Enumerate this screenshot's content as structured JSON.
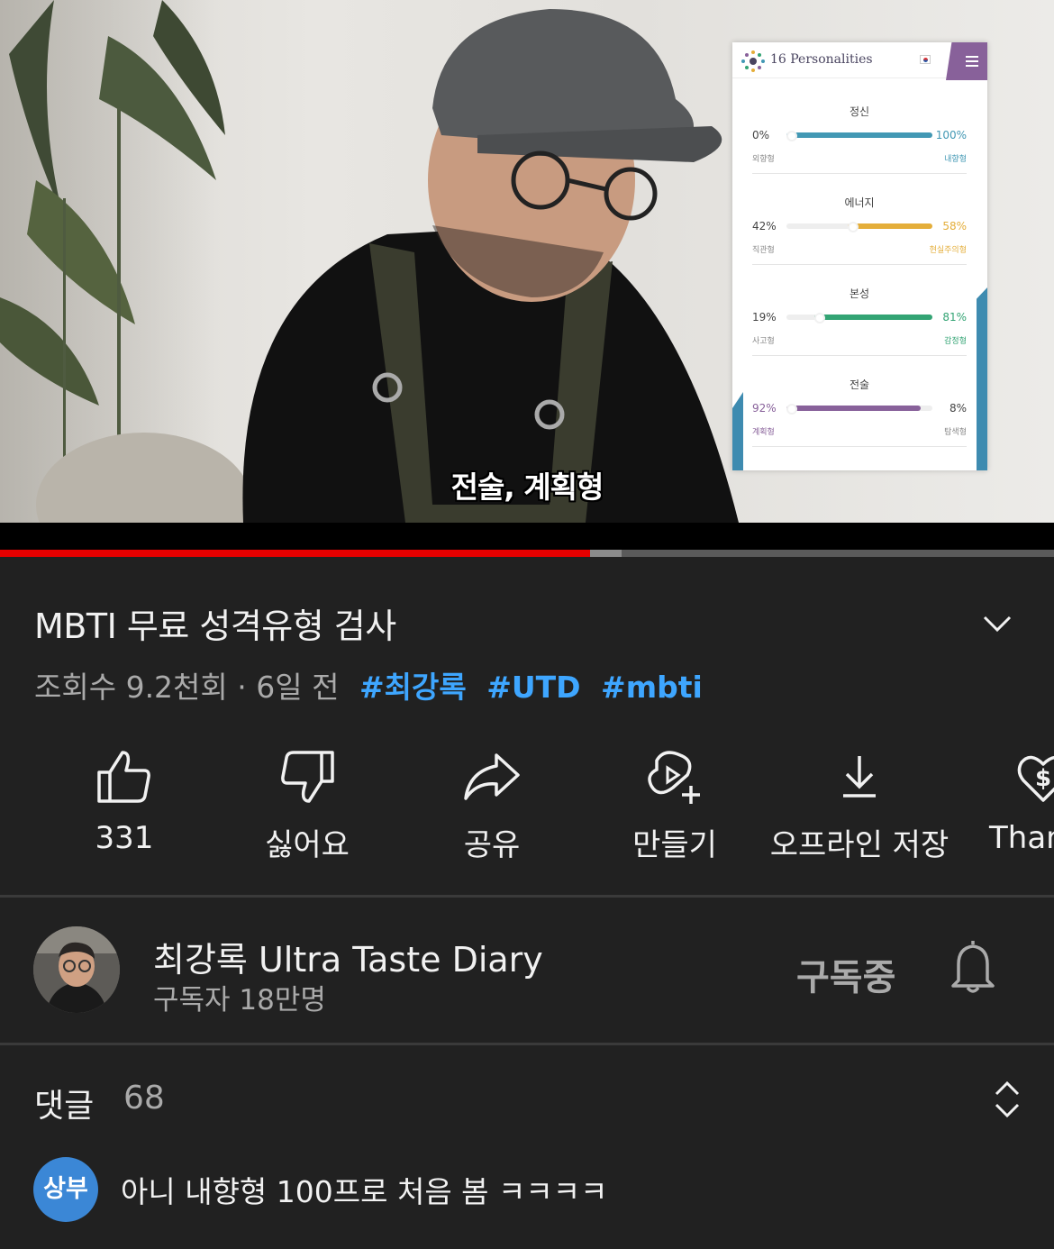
{
  "video": {
    "subtitle": "전술, 계획형",
    "overlay": {
      "brand": "16 Personalities",
      "traits": [
        {
          "name": "정신",
          "left_pct": "0%",
          "right_pct": "100%",
          "left_label": "외향형",
          "right_label": "내향형",
          "color": "#4298b4",
          "right_fraction": 1.0,
          "dominant": "right"
        },
        {
          "name": "에너지",
          "left_pct": "42%",
          "right_pct": "58%",
          "left_label": "직관형",
          "right_label": "현실주의형",
          "color": "#e4ae3a",
          "right_fraction": 0.58,
          "dominant": "right"
        },
        {
          "name": "본성",
          "left_pct": "19%",
          "right_pct": "81%",
          "left_label": "사고형",
          "right_label": "감정형",
          "color": "#33a474",
          "right_fraction": 0.81,
          "dominant": "right"
        },
        {
          "name": "전술",
          "left_pct": "92%",
          "right_pct": "8%",
          "left_label": "계획형",
          "right_label": "탐색형",
          "color": "#88619a",
          "left_fraction": 0.92,
          "dominant": "left"
        }
      ]
    },
    "progress": {
      "played_fraction": 0.56,
      "buffered_fraction": 0.59
    }
  },
  "info": {
    "title": "MBTI 무료 성격유형 검사",
    "views": "조회수 9.2천회 · 6일 전",
    "hashtags": [
      "#최강록",
      "#UTD",
      "#mbti"
    ]
  },
  "actions": [
    {
      "label": "331",
      "icon": "thumbs-up-icon"
    },
    {
      "label": "싫어요",
      "icon": "thumbs-down-icon"
    },
    {
      "label": "공유",
      "icon": "share-icon"
    },
    {
      "label": "만들기",
      "icon": "create-icon"
    },
    {
      "label": "오프라인 저장",
      "icon": "download-icon"
    },
    {
      "label": "Than",
      "icon": "thanks-icon"
    }
  ],
  "channel": {
    "name": "최강록 Ultra Taste Diary",
    "subscribers": "구독자 18만명",
    "subscribe_state": "구독중"
  },
  "comments": {
    "label": "댓글",
    "count": "68",
    "top_comment": {
      "avatar_text": "상부",
      "text": "아니 내향형 100프로 처음 봄 ㅋㅋㅋㅋ"
    }
  },
  "colors": {
    "background": "#212121",
    "accent_red": "#e60000",
    "hashtag_blue": "#3ea6ff"
  }
}
